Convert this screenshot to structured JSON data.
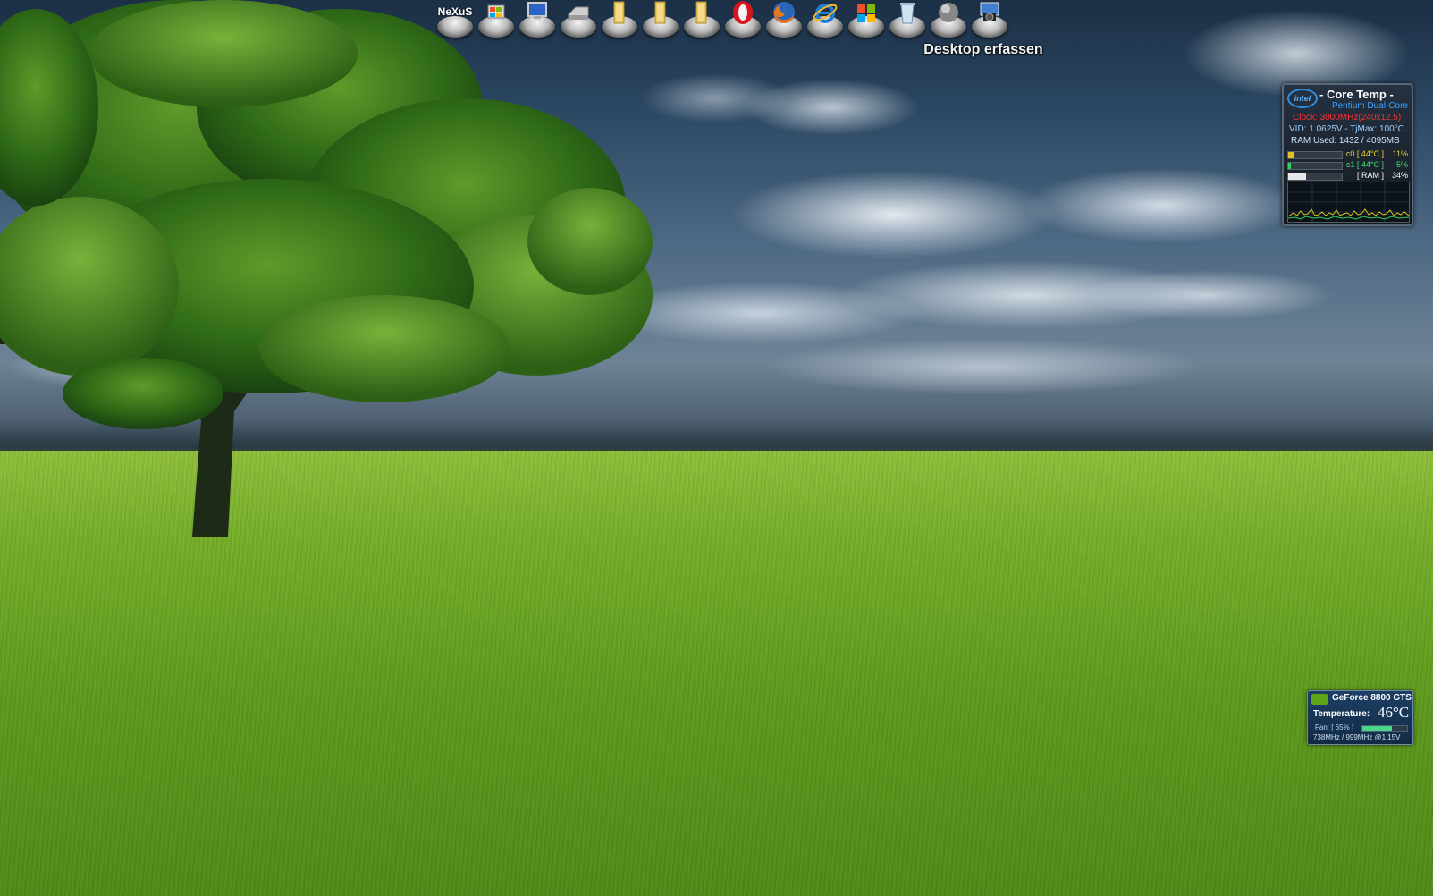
{
  "dock": {
    "items": [
      {
        "name": "nexus-logo",
        "label": "NeXuS"
      },
      {
        "name": "windows-explorer-icon"
      },
      {
        "name": "computer-icon"
      },
      {
        "name": "drive-icon"
      },
      {
        "name": "folder-icon-1"
      },
      {
        "name": "folder-icon-2"
      },
      {
        "name": "folder-icon-3"
      },
      {
        "name": "opera-icon"
      },
      {
        "name": "firefox-icon"
      },
      {
        "name": "internet-explorer-icon"
      },
      {
        "name": "windows-icon"
      },
      {
        "name": "recycle-bin-icon"
      },
      {
        "name": "globe-icon"
      },
      {
        "name": "camera-icon"
      }
    ],
    "hover_label": "Desktop erfassen"
  },
  "core_temp": {
    "logo": "intel",
    "title": "- Core Temp -",
    "cpu": "Pentium Dual-Core",
    "clock": "Clock: 3000MHz(240x12.5)",
    "vid": "VID: 1.0625V - TjMax: 100°C",
    "ram_used": "RAM Used: 1432 / 4095MB",
    "rows": [
      {
        "label": "c0 [ 44°C ]",
        "percent": "11%",
        "level": 0.11,
        "color": "#e0c020"
      },
      {
        "label": "c1 [ 44°C ]",
        "percent": "5%",
        "level": 0.05,
        "color": "#30d060"
      },
      {
        "label": "[ RAM ]",
        "percent": "34%",
        "level": 0.34,
        "color": "#e8e8e8"
      }
    ]
  },
  "gpu": {
    "name": "GeForce 8800 GTS",
    "temperature_label": "Temperature:",
    "temperature": "46°C",
    "fan": "Fan: [ 65% ]",
    "fan_level": 0.65,
    "clocks": "738MHz / 999MHz @1.15V"
  },
  "colors": {
    "sky": "#2c4863",
    "grass": "#76ae28",
    "coretemp_bg": "#1a232e",
    "gpu_bg": "#1d3f66"
  }
}
